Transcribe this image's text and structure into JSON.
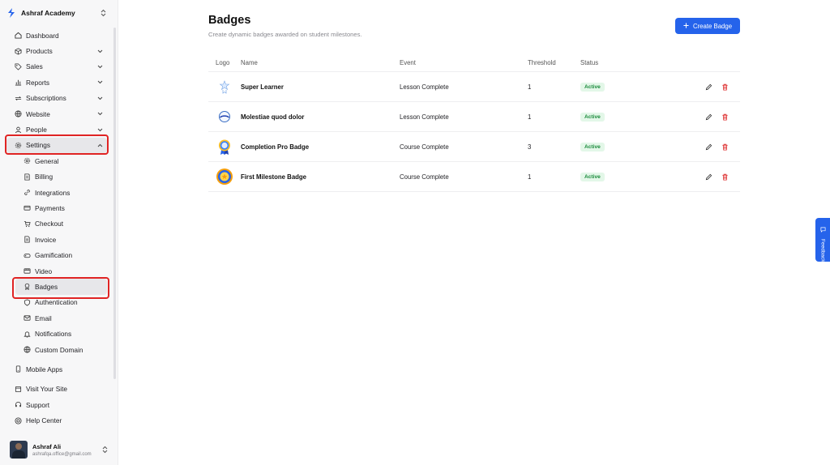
{
  "org": {
    "name": "Ashraf Academy"
  },
  "nav": {
    "dashboard": "Dashboard",
    "products": "Products",
    "sales": "Sales",
    "reports": "Reports",
    "subscriptions": "Subscriptions",
    "website": "Website",
    "people": "People",
    "settings": "Settings",
    "settings_items": {
      "general": "General",
      "billing": "Billing",
      "integrations": "Integrations",
      "payments": "Payments",
      "checkout": "Checkout",
      "invoice": "Invoice",
      "gamification": "Gamification",
      "video": "Video",
      "badges": "Badges",
      "authentication": "Authentication",
      "email": "Email",
      "notifications": "Notifications",
      "custom_domain": "Custom Domain"
    },
    "mobile_apps": "Mobile Apps",
    "visit_site": "Visit Your Site",
    "support": "Support",
    "help_center": "Help Center"
  },
  "user": {
    "name": "Ashraf Ali",
    "email": "ashrafqa.office@gmail.com"
  },
  "page": {
    "title": "Badges",
    "subtitle": "Create dynamic badges awarded on student milestones.",
    "create_button": "Create Badge"
  },
  "table": {
    "headers": {
      "logo": "Logo",
      "name": "Name",
      "event": "Event",
      "threshold": "Threshold",
      "status": "Status"
    },
    "rows": [
      {
        "name": "Super Learner",
        "event": "Lesson Complete",
        "threshold": "1",
        "status": "Active",
        "logo_icon": "super-learner-badge-icon"
      },
      {
        "name": "Molestiae quod dolor",
        "event": "Lesson Complete",
        "threshold": "1",
        "status": "Active",
        "logo_icon": "globe-badge-icon"
      },
      {
        "name": "Completion Pro Badge",
        "event": "Course Complete",
        "threshold": "3",
        "status": "Active",
        "logo_icon": "medal-badge-icon"
      },
      {
        "name": "First Milestone Badge",
        "event": "Course Complete",
        "threshold": "1",
        "status": "Active",
        "logo_icon": "gold-medal-badge-icon"
      }
    ]
  },
  "feedback": {
    "label": "Feedback"
  },
  "colors": {
    "accent": "#2563eb",
    "highlight": "#e02424",
    "status_bg": "#e3f7e8",
    "status_text": "#1a8a3b",
    "delete": "#dc2626"
  }
}
